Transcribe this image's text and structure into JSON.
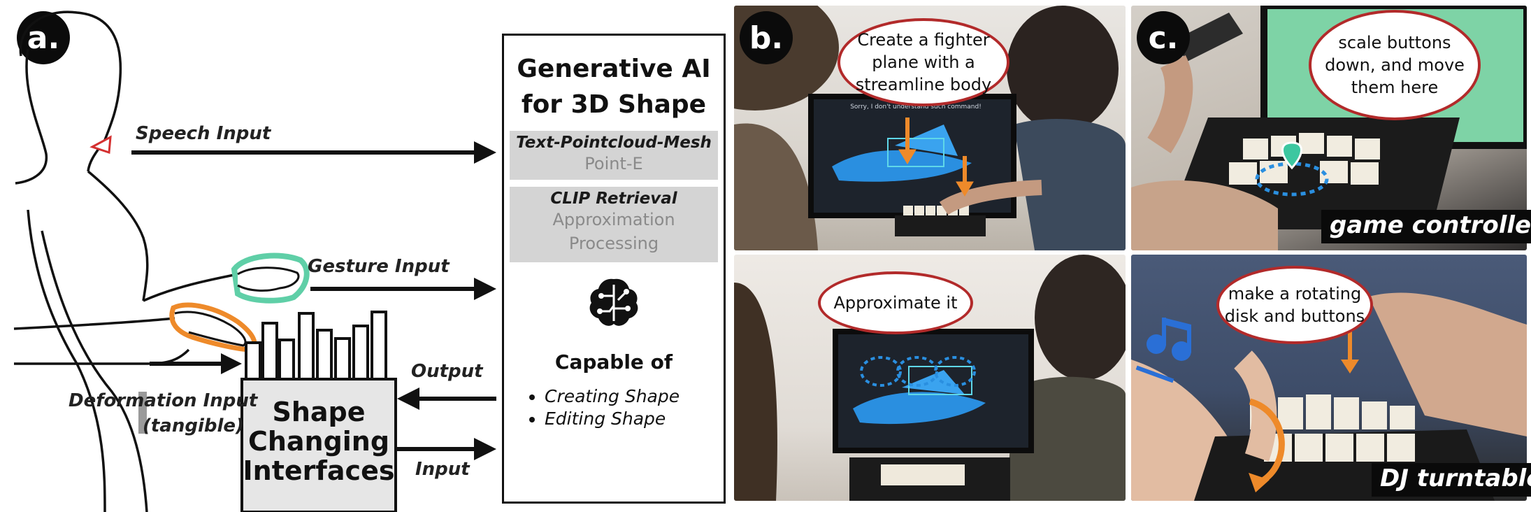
{
  "panel_a": {
    "badge": "a.",
    "speech_label": "Speech Input",
    "gesture_label": "Gesture Input",
    "deformation_label_1": "Deformation Input",
    "deformation_label_2": "(tangible)",
    "output_label": "Output",
    "input_label": "Input",
    "sci_lines": [
      "Shape",
      "Changing",
      "Interfaces"
    ],
    "ai_box": {
      "title_1": "Generative AI",
      "title_2": "for 3D Shape",
      "method_1_title": "Text-Pointcloud-Mesh",
      "method_1_sub": "Point-E",
      "method_2_title": "CLIP Retrieval",
      "method_2_sub_1": "Approximation",
      "method_2_sub_2": "Processing",
      "capable_title": "Capable of",
      "capabilities": [
        "Creating Shape",
        "Editing Shape"
      ]
    }
  },
  "panel_b": {
    "badge": "b.",
    "top_bubble": [
      "Create a fighter",
      "plane with a",
      "streamline body"
    ],
    "screen_text": "Sorry, I don't understand such command!",
    "bottom_bubble": "Approximate it"
  },
  "panel_c": {
    "badge": "c.",
    "top_bubble": [
      "scale buttons",
      "down, and move",
      "them here"
    ],
    "top_caption": "game controller",
    "bottom_bubble": [
      "make a rotating",
      "disk and buttons"
    ],
    "bottom_caption": "DJ turntable"
  },
  "colors": {
    "accent_orange": "#ee8a2a",
    "bubble_border": "#b22a2a",
    "gesture_highlight": "#5fcfa7",
    "mesh_blue": "#2a8fe0"
  }
}
